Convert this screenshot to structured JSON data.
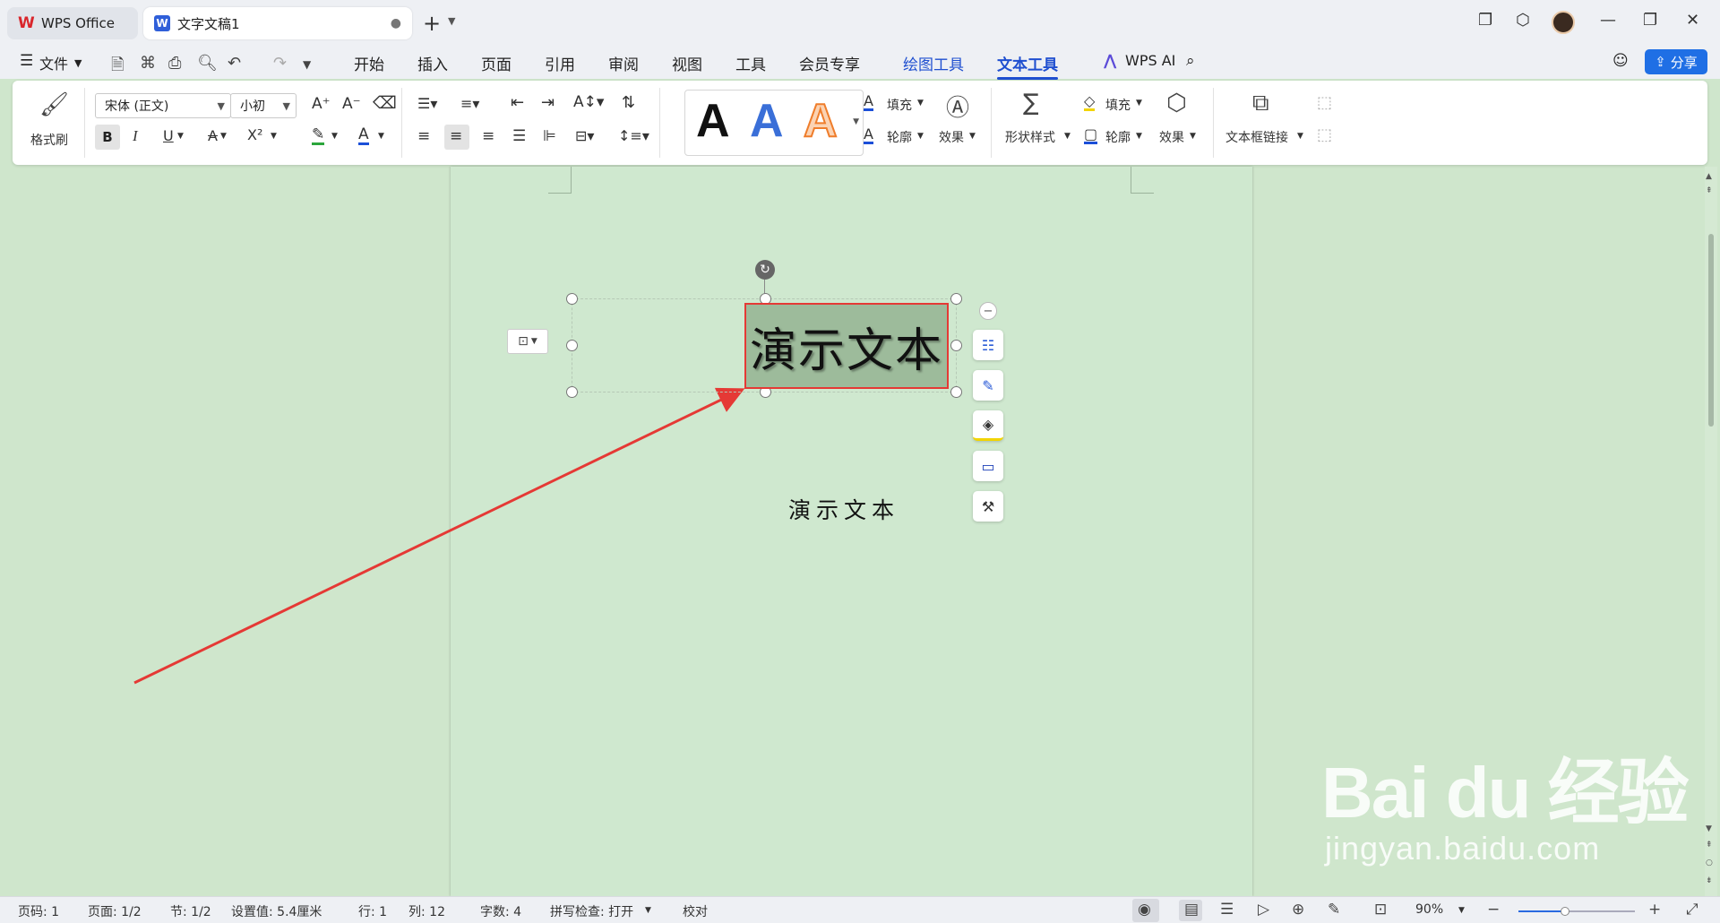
{
  "titlebar": {
    "app_tab": "WPS Office",
    "doc_tab": "文字文稿1",
    "doc_tab_unsaved": "●",
    "new_tab": "+"
  },
  "menubar": {
    "file": "文件",
    "tabs": [
      "开始",
      "插入",
      "页面",
      "引用",
      "审阅",
      "视图",
      "工具",
      "会员专享",
      "绘图工具",
      "文本工具"
    ],
    "active_tab": "文本工具",
    "wps_ai": "WPS AI",
    "share": "分享"
  },
  "ribbon": {
    "format_painter": "格式刷",
    "font_name": "宋体 (正文)",
    "font_size": "小初",
    "bold": "B",
    "italic": "I",
    "underline": "U",
    "art_gallery": [
      "A",
      "A",
      "A"
    ],
    "text_fill": "填充",
    "text_outline": "轮廓",
    "text_effect": "效果",
    "shape_style": "形状样式",
    "shape_fill": "填充",
    "shape_outline": "轮廓",
    "shape_effect": "效果",
    "textbox_link": "文本框链接"
  },
  "document": {
    "selected_text": "演示文本",
    "plain_text": "演示文本"
  },
  "watermark": {
    "main": "Bai du 经验",
    "sub": "jingyan.baidu.com"
  },
  "statusbar": {
    "page_code": "页码: 1",
    "pages": "页面: 1/2",
    "section": "节: 1/2",
    "setting": "设置值: 5.4厘米",
    "row": "行: 1",
    "col": "列: 12",
    "word_count": "字数: 4",
    "spell_check": "拼写检查: 打开",
    "proofread": "校对",
    "zoom": "90%",
    "zoom_level": 0.4
  },
  "colors": {
    "accent": "#1f4fd0",
    "highlight_red": "#e53935",
    "page_bg": "#cfe8cf"
  }
}
